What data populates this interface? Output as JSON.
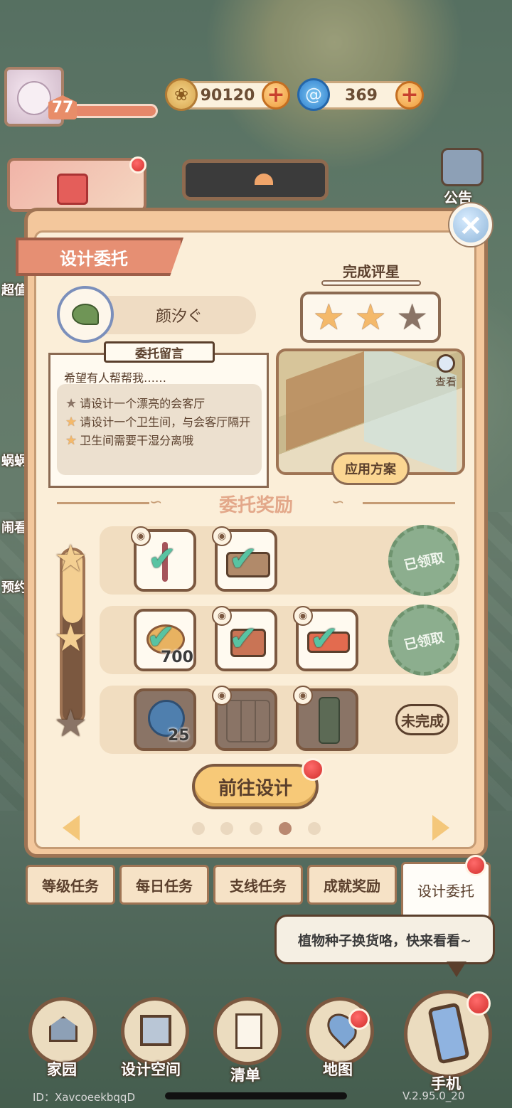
{
  "hud": {
    "level": "77",
    "coins": "90120",
    "gems": "369",
    "notice_label": "公告",
    "side_labels": [
      "超值",
      "蜗蜗",
      "闹看",
      "预约"
    ]
  },
  "panel": {
    "title": "设计委托",
    "client_name": "颜汐ぐ",
    "rating_title": "完成评星",
    "rating_filled_stars": 2,
    "rating_total_stars": 3,
    "message_tag": "委托留言",
    "message_greeting": "希望有人帮帮我……",
    "requirements": [
      {
        "text": "请设计一个漂亮的会客厅",
        "done": false
      },
      {
        "text": "请设计一个卫生间，与会客厅隔开",
        "done": true
      },
      {
        "text": "卫生间需要干湿分离哦",
        "done": true
      }
    ],
    "view_label": "查看",
    "apply_button": "应用方案",
    "rewards_title": "委托奖励",
    "tiers": [
      {
        "status_label": "已领取",
        "slot_count_label": ""
      },
      {
        "status_label": "已领取",
        "slot_count_label": "700"
      },
      {
        "status_label": "未完成",
        "slot_count_label": "25"
      }
    ],
    "go_button": "前往设计",
    "pagination": {
      "total": 5,
      "current": 4
    }
  },
  "task_tabs": [
    "等级任务",
    "每日任务",
    "支线任务",
    "成就奖励",
    "设计委托"
  ],
  "bubble_text": "植物种子换货咯，快来看看~",
  "bottom_nav": [
    "家园",
    "设计空间",
    "清单",
    "地图",
    "手机"
  ],
  "footer": {
    "id": "ID：XavcoeekbqqD",
    "version": "V.2.95.0_20"
  },
  "colors": {
    "panel_bg": "#fbeed8",
    "accent_orange": "#e68f73",
    "check_green": "#58c3a2",
    "stamp_green": "#8cae8e",
    "badge_red": "#d2302c"
  }
}
